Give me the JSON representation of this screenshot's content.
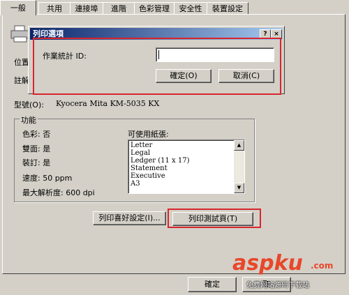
{
  "tabs": [
    "一般",
    "共用",
    "連接埠",
    "進階",
    "色彩管理",
    "安全性",
    "裝置設定"
  ],
  "labels": {
    "location": "位置",
    "comment": "註解",
    "model_label": "型號(O):",
    "model_value": "Kyocera Mita KM-5035 KX"
  },
  "features": {
    "title": "功能",
    "color": "色彩: 否",
    "duplex": "雙面: 是",
    "staple": "裝訂: 是",
    "speed": "速度: 50 ppm",
    "resolution": "最大解析度: 600 dpi",
    "paper_label": "可使用紙張:",
    "paper_list": [
      "Letter",
      "Legal",
      "Ledger (11 x 17)",
      "Statement",
      "Executive",
      "A3"
    ]
  },
  "buttons": {
    "preferences": "列印喜好設定(I)...",
    "test_page": "列印測試頁(T)",
    "ok": "確定",
    "cancel_partial": "取"
  },
  "dialog": {
    "title": "列印選項",
    "help_btn": "?",
    "close_btn": "×",
    "job_id_label": "作業統計 ID:",
    "job_id_value": "",
    "ok": "確定(O)",
    "cancel": "取消(C)"
  },
  "watermark": {
    "brand": "aspku",
    "suffix": ".com",
    "sub": "免费网站源码下载站"
  },
  "colors": {
    "highlight": "#d8262c",
    "watermark": "#e8472a"
  }
}
